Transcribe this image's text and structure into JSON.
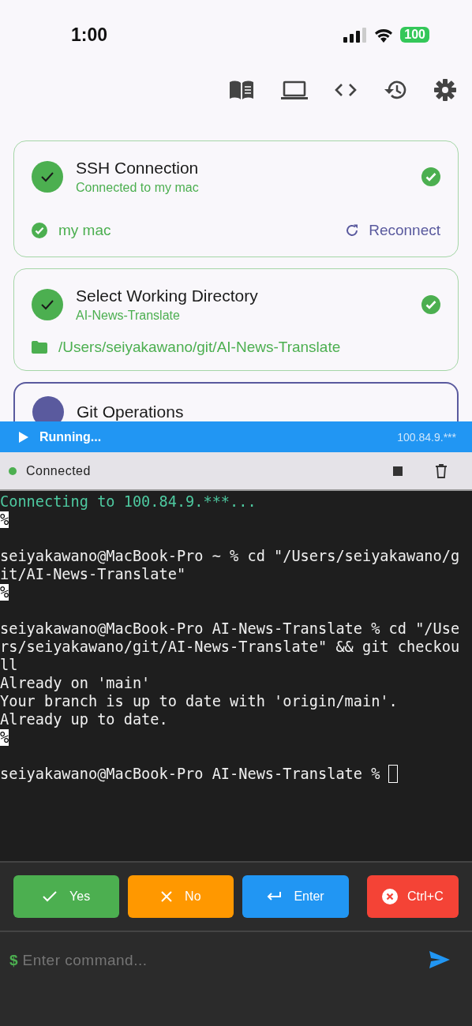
{
  "status_bar": {
    "time": "1:00",
    "battery": "100"
  },
  "toolbar": {
    "icons": [
      {
        "kind": "book"
      },
      {
        "kind": "laptop"
      },
      {
        "kind": "code"
      },
      {
        "kind": "history"
      },
      {
        "kind": "settings"
      }
    ]
  },
  "steps": [
    {
      "title": "SSH Connection",
      "subtitle": "Connected to my mac",
      "completed": true,
      "footer": {
        "kind": "host",
        "label": "my mac",
        "action": "Reconnect"
      }
    },
    {
      "title": "Select Working Directory",
      "subtitle": "AI-News-Translate",
      "completed": true,
      "footer": {
        "kind": "path",
        "label": "/Users/seiyakawano/git/AI-News-Translate"
      }
    },
    {
      "title": "Git Operations",
      "completed": false
    }
  ],
  "run_bar": {
    "label": "Running...",
    "host": "100.84.9.***"
  },
  "connection": {
    "label": "Connected",
    "connected": true
  },
  "terminal": {
    "lines": [
      {
        "kind": "info",
        "text": "Connecting to 100.84.9.***..."
      },
      {
        "kind": "marker",
        "text": "%"
      },
      {
        "kind": "blank"
      },
      {
        "kind": "output",
        "text": "seiyakawano@MacBook-Pro ~ % cd \"/Users/seiyakawano/g"
      },
      {
        "kind": "output",
        "text": "it/AI-News-Translate\""
      },
      {
        "kind": "marker",
        "text": "%"
      },
      {
        "kind": "blank"
      },
      {
        "kind": "output",
        "text": "seiyakawano@MacBook-Pro AI-News-Translate % cd \"/Use"
      },
      {
        "kind": "output",
        "text": "rs/seiyakawano/git/AI-News-Translate\" && git checkou"
      },
      {
        "kind": "output",
        "text": "ll"
      },
      {
        "kind": "output",
        "text": "Already on 'main'"
      },
      {
        "kind": "output",
        "text": "Your branch is up to date with 'origin/main'."
      },
      {
        "kind": "output",
        "text": "Already up to date."
      },
      {
        "kind": "marker",
        "text": "%"
      },
      {
        "kind": "blank"
      },
      {
        "kind": "prompt",
        "text": "seiyakawano@MacBook-Pro AI-News-Translate %"
      }
    ]
  },
  "quick_keys": [
    {
      "kind": "yes",
      "label": "Yes",
      "color": "#4caf50"
    },
    {
      "kind": "no",
      "label": "No",
      "color": "#ff9800"
    },
    {
      "kind": "enter",
      "label": "Enter",
      "color": "#2196f3"
    },
    {
      "kind": "cancel",
      "label": "Ctrl+C",
      "color": "#f44336"
    }
  ],
  "command": {
    "prefix": "$",
    "placeholder": "Enter command..."
  }
}
